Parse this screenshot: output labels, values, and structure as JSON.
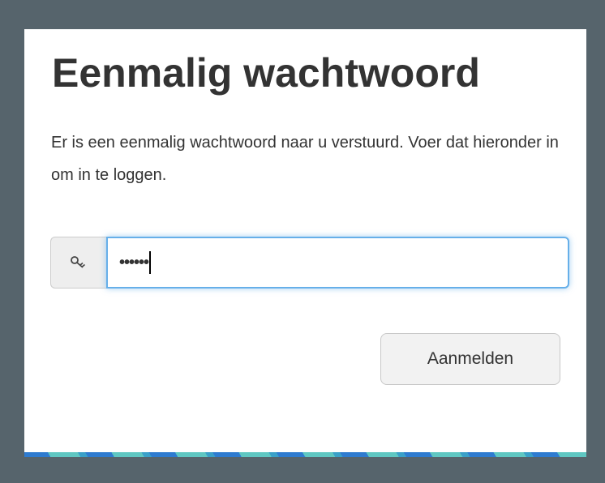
{
  "dialog": {
    "title": "Eenmalig wachtwoord",
    "description": "Er is een eenmalig wachtwoord naar u verstuurd. Voer dat hieronder in om in te loggen.",
    "password_field": {
      "icon": "key-icon",
      "masked_value": "••••••"
    },
    "submit_label": "Aanmelden"
  },
  "colors": {
    "backdrop": "#56646c",
    "card": "#ffffff",
    "focus_border": "#66afe9",
    "stripe_blue": "#2e7bd0",
    "stripe_teal": "#5fc7c2"
  }
}
